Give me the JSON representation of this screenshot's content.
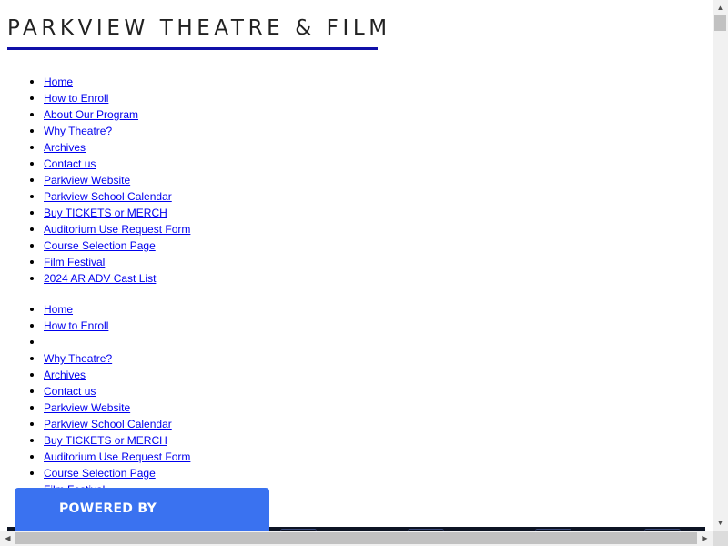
{
  "site": {
    "title": "PARKVIEW THEATRE & FILM",
    "underline_color": "#1010a8"
  },
  "nav_primary": {
    "items": [
      {
        "label": "Home"
      },
      {
        "label": "How to Enroll"
      },
      {
        "label": "About Our Program"
      },
      {
        "label": "Why Theatre?"
      },
      {
        "label": "Archives"
      },
      {
        "label": "Contact us"
      },
      {
        "label": "Parkview Website"
      },
      {
        "label": "Parkview School Calendar"
      },
      {
        "label": "Buy TICKETS or MERCH"
      },
      {
        "label": "Auditorium Use Request Form"
      },
      {
        "label": "Course Selection Page"
      },
      {
        "label": "Film Festival"
      },
      {
        "label": "2024 AR ADV Cast List"
      }
    ]
  },
  "nav_secondary": {
    "items": [
      {
        "label": "Home"
      },
      {
        "label": "How to Enroll"
      },
      {
        "label": ""
      },
      {
        "label": "Why Theatre?"
      },
      {
        "label": "Archives"
      },
      {
        "label": "Contact us"
      },
      {
        "label": "Parkview Website"
      },
      {
        "label": "Parkview School Calendar"
      },
      {
        "label": "Buy TICKETS or MERCH"
      },
      {
        "label": "Auditorium Use Request Form"
      },
      {
        "label": "Course Selection Page"
      },
      {
        "label": "Film Festival"
      }
    ]
  },
  "badge": {
    "label": "POWERED BY",
    "color": "#3a72f0"
  },
  "colors": {
    "link": "#0000ee",
    "banner": "#0d1424"
  }
}
